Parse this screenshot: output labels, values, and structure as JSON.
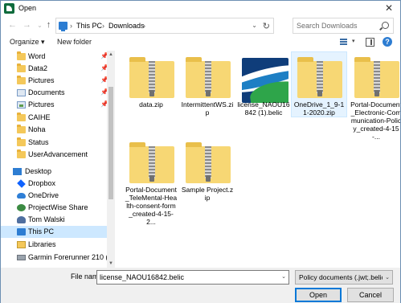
{
  "window": {
    "title": "Open",
    "close_glyph": "✕"
  },
  "address": {
    "back_glyph": "←",
    "forward_glyph": "→",
    "dropdown_glyph": "⌄",
    "up_glyph": "↑",
    "breadcrumb": [
      "This PC",
      "Downloads"
    ],
    "sep_glyph": "›",
    "addr_dropdown_glyph": "⌄",
    "refresh_glyph": "↻"
  },
  "search": {
    "placeholder": "Search Downloads"
  },
  "toolbar": {
    "organize_label": "Organize ▾",
    "new_folder_label": "New folder",
    "view_caret": "▾",
    "help_glyph": "?"
  },
  "nav": {
    "items": [
      {
        "label": "Word",
        "icon": "folder-icon",
        "pinned": true
      },
      {
        "label": "Data2",
        "icon": "folder-icon",
        "pinned": true
      },
      {
        "label": "Pictures",
        "icon": "folder-icon",
        "pinned": true
      },
      {
        "label": "Documents",
        "icon": "documents-icon",
        "pinned": true
      },
      {
        "label": "Pictures",
        "icon": "pictures-icon",
        "pinned": true
      },
      {
        "label": "CAIHE",
        "icon": "folder-icon",
        "pinned": false
      },
      {
        "label": "Noha",
        "icon": "folder-icon",
        "pinned": false
      },
      {
        "label": "Status",
        "icon": "folder-icon",
        "pinned": false
      },
      {
        "label": "UserAdvancement",
        "icon": "folder-icon",
        "pinned": false
      },
      {
        "label": "Desktop",
        "icon": "desktop-icon",
        "pinned": false
      },
      {
        "label": "Dropbox",
        "icon": "dropbox-icon",
        "pinned": false
      },
      {
        "label": "OneDrive",
        "icon": "onedrive-icon",
        "pinned": false
      },
      {
        "label": "ProjectWise Share",
        "icon": "projectwise-icon",
        "pinned": false
      },
      {
        "label": "Tom Walski",
        "icon": "user-icon",
        "pinned": false
      },
      {
        "label": "This PC",
        "icon": "this-pc-icon",
        "pinned": false
      },
      {
        "label": "Libraries",
        "icon": "libraries-icon",
        "pinned": false
      },
      {
        "label": "Garmin Forerunner 210 (H:)",
        "icon": "drive-icon",
        "pinned": false
      }
    ],
    "pin_glyph": "📌",
    "scroll_up_glyph": "▲",
    "scroll_down_glyph": "▼"
  },
  "files": [
    {
      "name": "data.zip",
      "type": "zip",
      "selected": false
    },
    {
      "name": "IntermittentWS.zip",
      "type": "zip",
      "selected": false
    },
    {
      "name": "license_NAOU16842 (1).belic",
      "type": "belic",
      "selected": false
    },
    {
      "name": "OneDrive_1_9-11-2020.zip",
      "type": "zip",
      "selected": true
    },
    {
      "name": "Portal-Document_Electronic-Communication-Policy_created-4-15-...",
      "type": "zip",
      "selected": false
    },
    {
      "name": "Portal-Document_TeleMental-Health-consent-form_created-4-15-2...",
      "type": "zip",
      "selected": false
    },
    {
      "name": "Sample Project.zip",
      "type": "zip",
      "selected": false
    }
  ],
  "footer": {
    "filename_label": "File name:",
    "filename_value": "license_NAOU16842.belic",
    "filename_caret": "⌄",
    "filter_value": "Policy documents (.jwt;.belic;.z",
    "filter_caret": "⌄",
    "open_label": "Open",
    "cancel_label": "Cancel"
  },
  "colors": {
    "selection": "#cde8ff",
    "accent": "#0078d7",
    "folder": "#f4c85a"
  }
}
